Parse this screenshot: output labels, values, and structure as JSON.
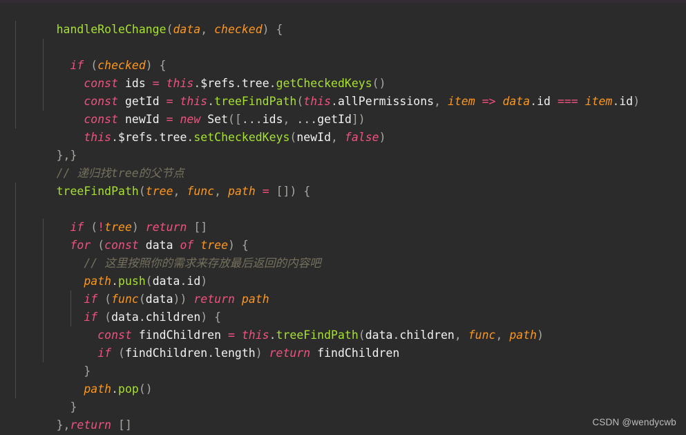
{
  "editor": {
    "background_color": "#2b2b2b",
    "top_strip_color": "#332c35",
    "default_text_color": "#d8d8d2",
    "colors": {
      "keyword": "#f0527f",
      "function": "#a6e22e",
      "parameter": "#fd971f",
      "identifier": "#f2f2f0",
      "punctuation": "#a8a8a2",
      "comment": "#75715e",
      "indent_guide": "#4d4d4d"
    },
    "language": "javascript",
    "lines": [
      {
        "n": 1,
        "indent": 0,
        "text": "handleRoleChange(data, checked) {"
      },
      {
        "n": 2,
        "indent": 1,
        "text": "if (checked) {"
      },
      {
        "n": 3,
        "indent": 2,
        "text": "const ids = this.$refs.tree.getCheckedKeys()"
      },
      {
        "n": 4,
        "indent": 2,
        "text": "const getId = this.treeFindPath(this.allPermissions, item => data.id === item.id)"
      },
      {
        "n": 5,
        "indent": 2,
        "text": "const newId = new Set([...ids, ...getId])"
      },
      {
        "n": 6,
        "indent": 2,
        "text": "this.$refs.tree.setCheckedKeys(newId, false)"
      },
      {
        "n": 7,
        "indent": 1,
        "text": "}"
      },
      {
        "n": 8,
        "indent": 0,
        "text": "},"
      },
      {
        "n": 9,
        "indent": 0,
        "text": "// 递归找tree的父节点"
      },
      {
        "n": 10,
        "indent": 0,
        "text": "treeFindPath(tree, func, path = []) {"
      },
      {
        "n": 11,
        "indent": 1,
        "text": "if (!tree) return []"
      },
      {
        "n": 12,
        "indent": 1,
        "text": "for (const data of tree) {"
      },
      {
        "n": 13,
        "indent": 2,
        "text": "// 这里按照你的需求来存放最后返回的内容吧"
      },
      {
        "n": 14,
        "indent": 2,
        "text": "path.push(data.id)"
      },
      {
        "n": 15,
        "indent": 2,
        "text": "if (func(data)) return path"
      },
      {
        "n": 16,
        "indent": 2,
        "text": "if (data.children) {"
      },
      {
        "n": 17,
        "indent": 3,
        "text": "const findChildren = this.treeFindPath(data.children, func, path)"
      },
      {
        "n": 18,
        "indent": 3,
        "text": "if (findChildren.length) return findChildren"
      },
      {
        "n": 19,
        "indent": 2,
        "text": "}"
      },
      {
        "n": 20,
        "indent": 2,
        "text": "path.pop()"
      },
      {
        "n": 21,
        "indent": 1,
        "text": "}"
      },
      {
        "n": 22,
        "indent": 1,
        "text": "return []"
      },
      {
        "n": 23,
        "indent": 0,
        "text": "},"
      }
    ]
  },
  "watermark": {
    "text": "CSDN @wendycwb"
  }
}
